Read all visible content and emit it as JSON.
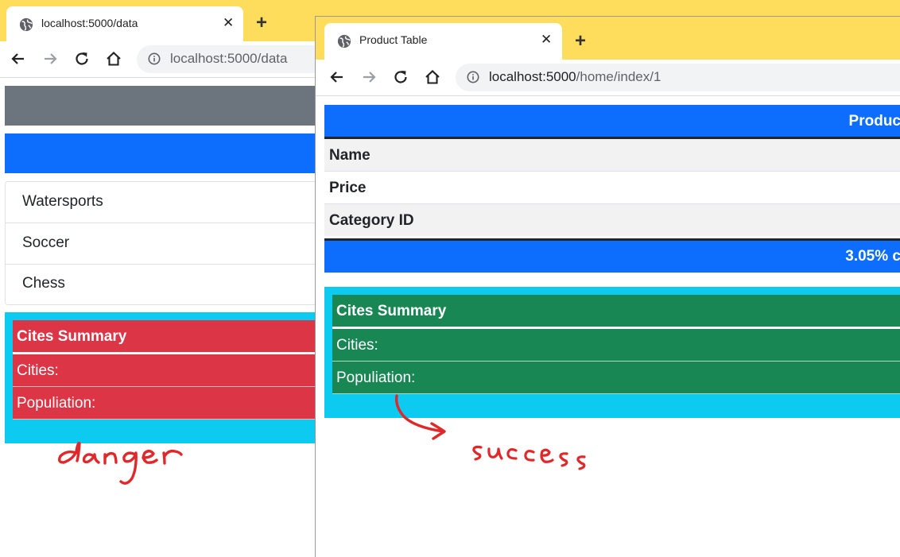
{
  "back_window": {
    "tab_title": "localhost:5000/data",
    "url": "localhost:5000/data",
    "categories": [
      "Watersports",
      "Soccer",
      "Chess"
    ],
    "summary": {
      "title": "Cites Summary",
      "cities_label": "Cities:",
      "population_label": "Populiation:",
      "color": "#dc3545"
    }
  },
  "front_window": {
    "tab_title": "Product Table",
    "url_host": "localhost:5000",
    "url_path": "/home/index/1",
    "product_header": "Produc",
    "rows": [
      "Name",
      "Price",
      "Category ID"
    ],
    "footer_text": "3.05% c",
    "summary": {
      "title": "Cites Summary",
      "cities_label": "Cities:",
      "population_label": "Populiation:",
      "color": "#198754"
    }
  },
  "annotations": {
    "left_label": "danger",
    "right_label": "success"
  },
  "colors": {
    "tabstrip": "#ffdd5c",
    "primary": "#0d6efd",
    "secondary": "#6c757d",
    "info": "#0dcaf0",
    "danger": "#dc3545",
    "success": "#198754",
    "annotation_ink": "#e0282a"
  }
}
